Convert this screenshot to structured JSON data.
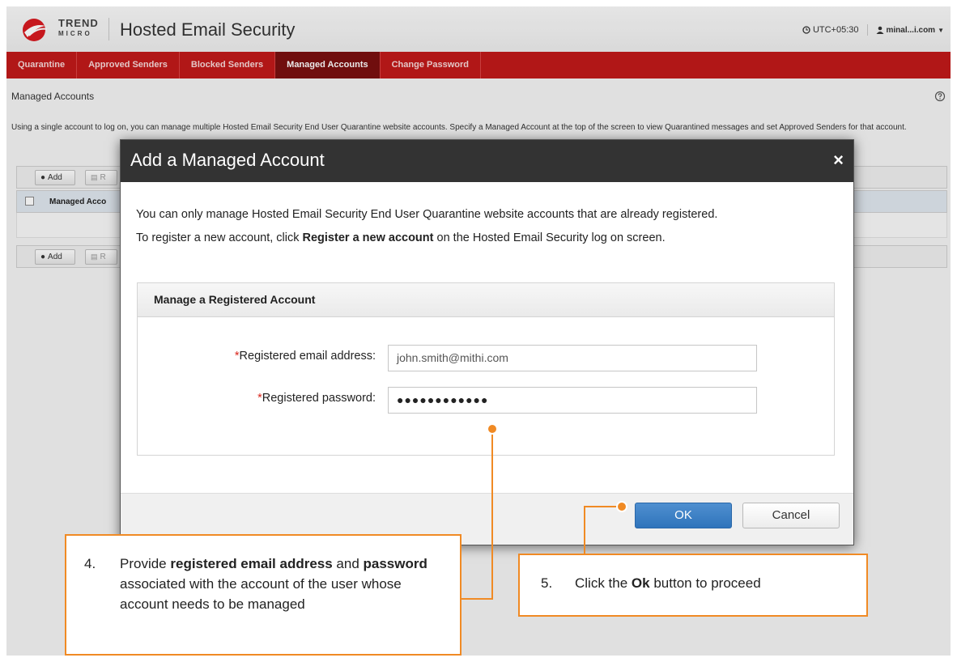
{
  "header": {
    "brand_line1": "TREND",
    "brand_line2": "MICRO",
    "product_name": "Hosted Email Security",
    "timezone": "UTC+05:30",
    "user": "minal...i.com"
  },
  "nav": {
    "items": [
      {
        "label": "Quarantine"
      },
      {
        "label": "Approved Senders"
      },
      {
        "label": "Blocked Senders"
      },
      {
        "label": "Managed Accounts"
      },
      {
        "label": "Change Password"
      }
    ],
    "active_index": 3
  },
  "page": {
    "title": "Managed Accounts",
    "description": "Using a single account to log on, you can manage multiple Hosted Email Security End User Quarantine website accounts. Specify a Managed Account at the top of the screen to view Quarantined messages and set Approved Senders for that account.",
    "toolbar_add": "Add",
    "toolbar_remove": "R",
    "column_header": "Managed Acco"
  },
  "modal": {
    "title": "Add a Managed Account",
    "close_symbol": "×",
    "intro_line": "You can only manage Hosted Email Security End User Quarantine website accounts that are already registered.",
    "register_pre": "To register a new account, click ",
    "register_bold": "Register a new account",
    "register_post": " on the Hosted Email Security log on screen.",
    "panel_title": "Manage a Registered Account",
    "email_label": "Registered email address:",
    "email_value": "john.smith@mithi.com",
    "password_label": "Registered password:",
    "password_value": "●●●●●●●●●●●●",
    "required_marker": "*",
    "ok_label": "OK",
    "cancel_label": "Cancel"
  },
  "callouts": {
    "step4": {
      "number": "4.",
      "pre": "Provide ",
      "bold1": "registered email address",
      "mid": " and ",
      "bold2": "password",
      "post": " associated with the account of the user whose account needs to be managed"
    },
    "step5": {
      "number": "5.",
      "pre": "Click the ",
      "bold": "Ok",
      "post": " button to proceed"
    }
  },
  "colors": {
    "nav_red": "#c11a1a",
    "nav_active": "#7a1010",
    "modal_header": "#333333",
    "primary_button": "#2f74bb",
    "callout_orange": "#f08a24",
    "required_red": "#d9261c"
  },
  "icons": {
    "logo": "trend-micro-logo",
    "clock": "clock-icon",
    "user": "user-icon",
    "help": "help-icon",
    "add": "plus-circle-icon",
    "remove": "trash-icon",
    "close": "close-icon"
  }
}
